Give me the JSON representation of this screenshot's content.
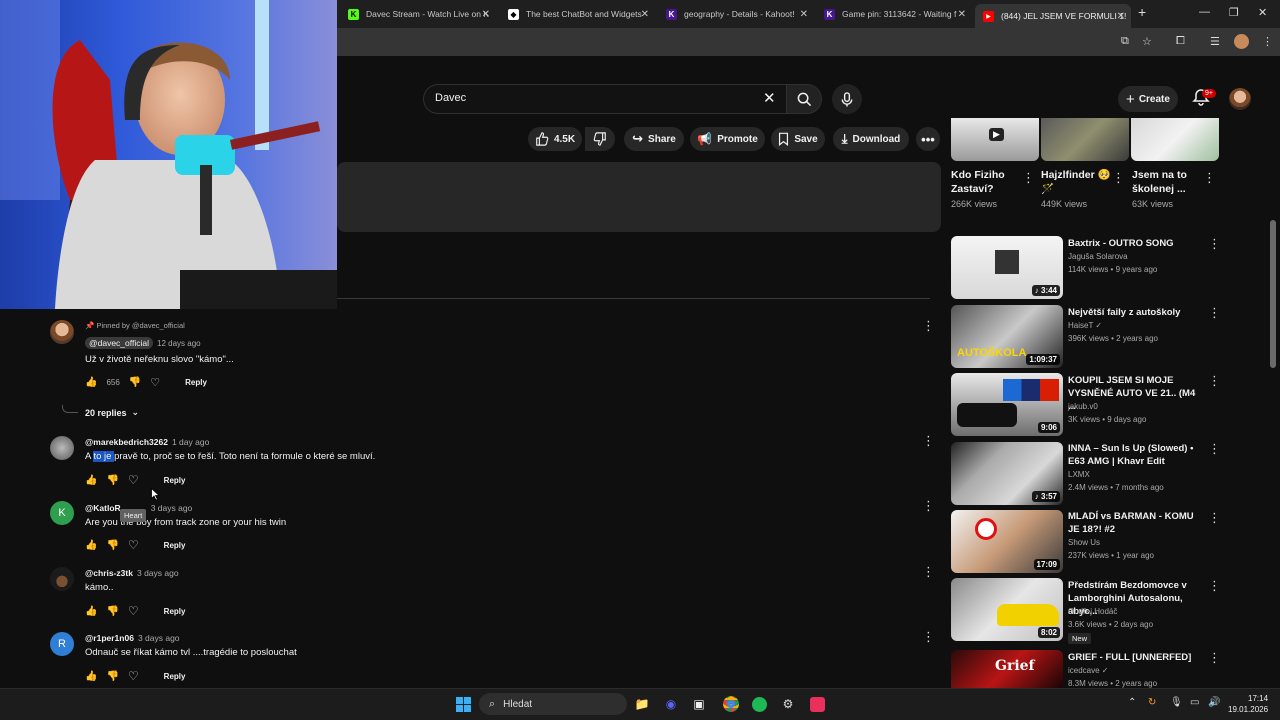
{
  "browser": {
    "tabs": [
      {
        "title": "Davec Stream - Watch Live on K",
        "fav": "K",
        "favcolor": "#53fc18"
      },
      {
        "title": "The best ChatBot and Widgets",
        "fav": "◆",
        "favcolor": "#2b2b2b"
      },
      {
        "title": "geography - Details - Kahoot!",
        "fav": "K!",
        "favcolor": "#46178f"
      },
      {
        "title": "Game pin: 3113642 - Waiting f",
        "fav": "K!",
        "favcolor": "#46178f"
      },
      {
        "title": "(844) JEL JSEM VE FORMULI 1!",
        "fav": "▶",
        "favcolor": "#ff0000"
      }
    ]
  },
  "youtube": {
    "search_value": "Davec",
    "create_label": "Create",
    "notif_count": "9+",
    "actions": {
      "likes": "4.5K",
      "share": "Share",
      "promote": "Promote",
      "save": "Save",
      "download": "Download"
    }
  },
  "comments": {
    "pinned": {
      "pinned_by": "Pinned by @davec_official",
      "author": "@davec_official",
      "time": "12 days ago",
      "text": "Už v životě neřeknu slovo \"kámo\"...",
      "likes": "656",
      "reply": "Reply",
      "replies_label": "20 replies"
    },
    "items": [
      {
        "author": "@marekbedrich3262",
        "time": "1 day ago",
        "text_pre": "A ",
        "text_hl": "to je ",
        "text_post": "pravě to, proč se to řeší. Toto není ta formule o které se mluví.",
        "reply": "Reply",
        "avatar": ""
      },
      {
        "author": "@KatloR",
        "time": "3 days ago",
        "text": "Are you the boy from track zone or your his twin",
        "reply": "Reply",
        "avatar": "K",
        "color": "#2e9e4f"
      },
      {
        "author": "@chris-z3tk",
        "time": "3 days ago",
        "text": "kámo..",
        "reply": "Reply",
        "avatar": ""
      },
      {
        "author": "@r1per1n06",
        "time": "3 days ago",
        "text": "Odnauč se říkat kámo tvl ....tragédie to poslouchat",
        "reply": "Reply",
        "avatar": "R",
        "color": "#2f7fd6"
      }
    ],
    "tooltip": "Heart"
  },
  "shelf": [
    {
      "title": "Kdo Fiziho Zastaví?",
      "views": "266K views"
    },
    {
      "title": "Hajzlfinder 🥺🪄",
      "views": "449K views"
    },
    {
      "title": "Jsem na to školenej ...",
      "views": "63K views"
    }
  ],
  "recommended": [
    {
      "title": "Baxtrix - OUTRO SONG",
      "channel": "Jaguša Solarova",
      "meta": "114K views • 9 years ago",
      "duration": "♪ 3:44"
    },
    {
      "title": "Největší faily z autoškoly",
      "channel": "HaiseT ✓",
      "meta": "396K views • 2 years ago",
      "duration": "1:09:37"
    },
    {
      "title": "KOUPIL JSEM SI MOJE VYSNĚNÉ AUTO VE 21.. (M4 ...",
      "channel": "jakub.v0",
      "meta": "3K views • 9 days ago",
      "duration": "9:06"
    },
    {
      "title": "INNA – Sun Is Up (Slowed) • E63 AMG | Khavr Edit",
      "channel": "LXMX",
      "meta": "2.4M views • 7 months ago",
      "duration": "♪ 3:57"
    },
    {
      "title": "MLADÍ vs BARMAN - KOMU JE 18?! #2",
      "channel": "Show Us",
      "meta": "237K views • 1 year ago",
      "duration": "17:09"
    },
    {
      "title": "Předstírám Bezdomovce v Lamborghini Autosalonu, abyc...",
      "channel": "Ondřej Hodáč",
      "meta": "3.6K views • 2 days ago",
      "badge": "New",
      "duration": "8:02"
    },
    {
      "title": "GRIEF - FULL [UNNERFED]",
      "channel": "icedcave ✓",
      "meta": "8.3M views • 2 years ago",
      "duration": ""
    }
  ],
  "taskbar": {
    "search": "Hledat",
    "time": "17:14",
    "date": "19.01.2026"
  }
}
